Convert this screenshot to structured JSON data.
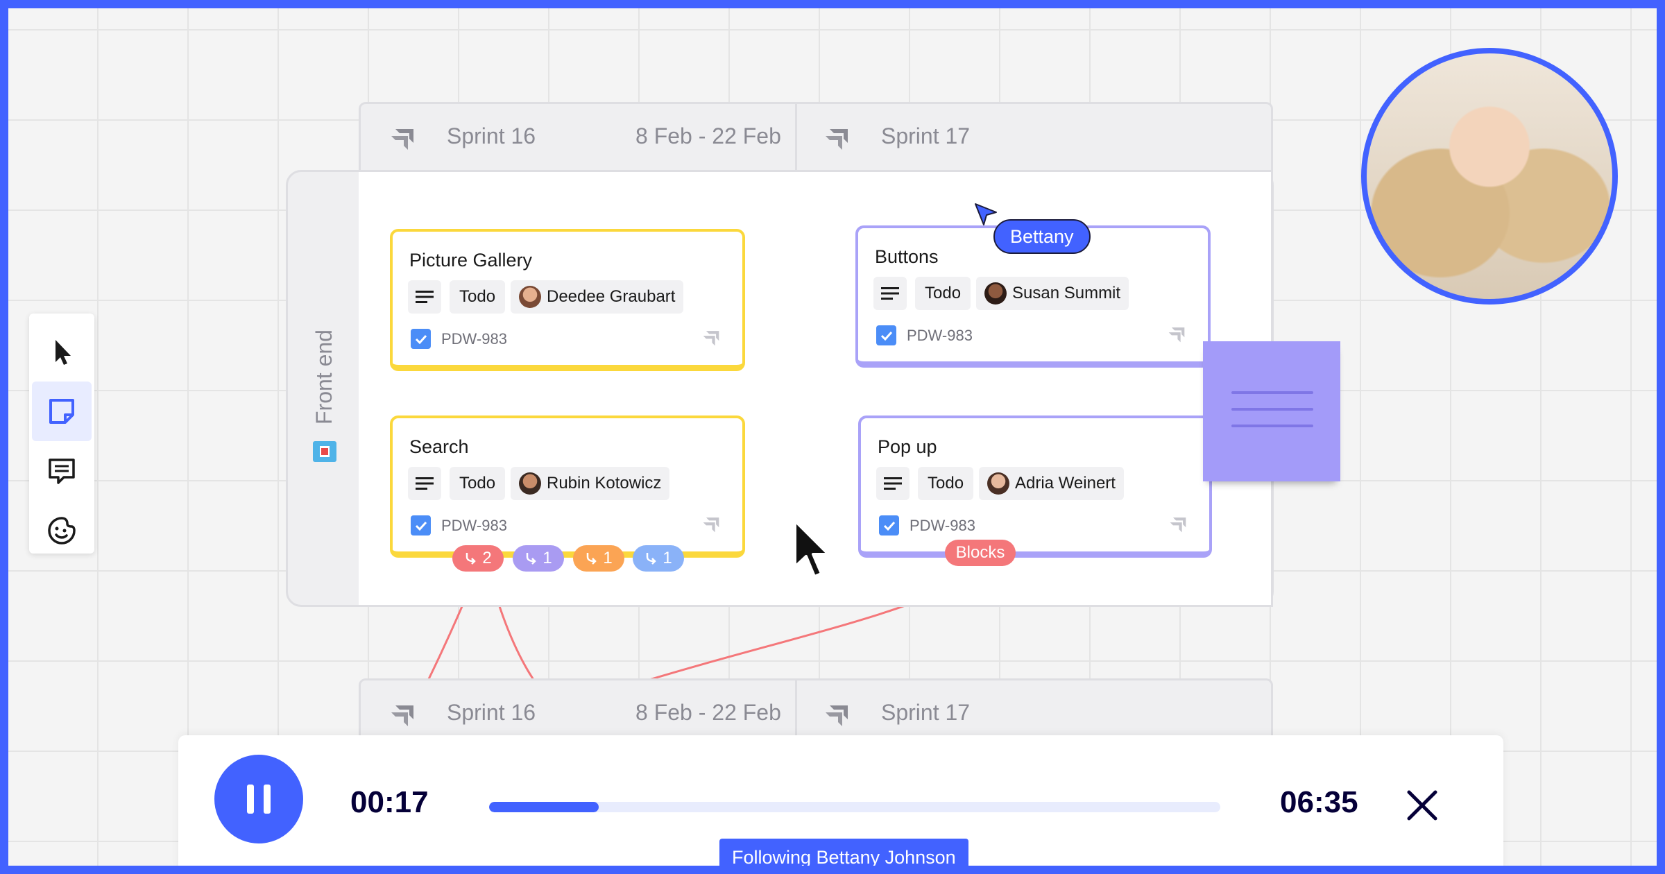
{
  "toolbar": {
    "tools": [
      {
        "name": "select-tool",
        "icon": "cursor-icon"
      },
      {
        "name": "sticky-note-tool",
        "icon": "sticky-note-icon",
        "active": true
      },
      {
        "name": "comment-tool",
        "icon": "comment-icon"
      },
      {
        "name": "emoji-tool",
        "icon": "emoji-sticker-icon"
      }
    ]
  },
  "sprints_top": {
    "sprint_a": "Sprint 16",
    "sprint_a_dates": "8 Feb - 22 Feb",
    "sprint_b": "Sprint 17"
  },
  "sprints_bottom": {
    "sprint_a": "Sprint 16",
    "sprint_a_dates": "8 Feb - 22 Feb",
    "sprint_b": "Sprint 17"
  },
  "lane": {
    "title": "Front end"
  },
  "cards": [
    {
      "title": "Picture Gallery",
      "status": "Todo",
      "assignee": "Deedee Graubart",
      "key": "PDW-983"
    },
    {
      "title": "Buttons",
      "status": "Todo",
      "assignee": "Susan Summit",
      "key": "PDW-983"
    },
    {
      "title": "Search",
      "status": "Todo",
      "assignee": "Rubin Kotowicz",
      "key": "PDW-983"
    },
    {
      "title": "Pop up",
      "status": "Todo",
      "assignee": "Adria Weinert",
      "key": "PDW-983"
    }
  ],
  "link_badges": [
    {
      "count": "2",
      "color": "#f4777a"
    },
    {
      "count": "1",
      "color": "#a99bf2"
    },
    {
      "count": "1",
      "color": "#fba454"
    },
    {
      "count": "1",
      "color": "#8ab2f8"
    }
  ],
  "blocks_label": "Blocks",
  "collaborator": {
    "name": "Bettany"
  },
  "player": {
    "elapsed": "00:17",
    "total": "06:35",
    "progress": 0.15,
    "following": "Following Bettany Johnson"
  },
  "colors": {
    "accent": "#4262ff",
    "yellow": "#fbd83c",
    "purple": "#a9a2f8",
    "sticky": "#a39bf9"
  }
}
